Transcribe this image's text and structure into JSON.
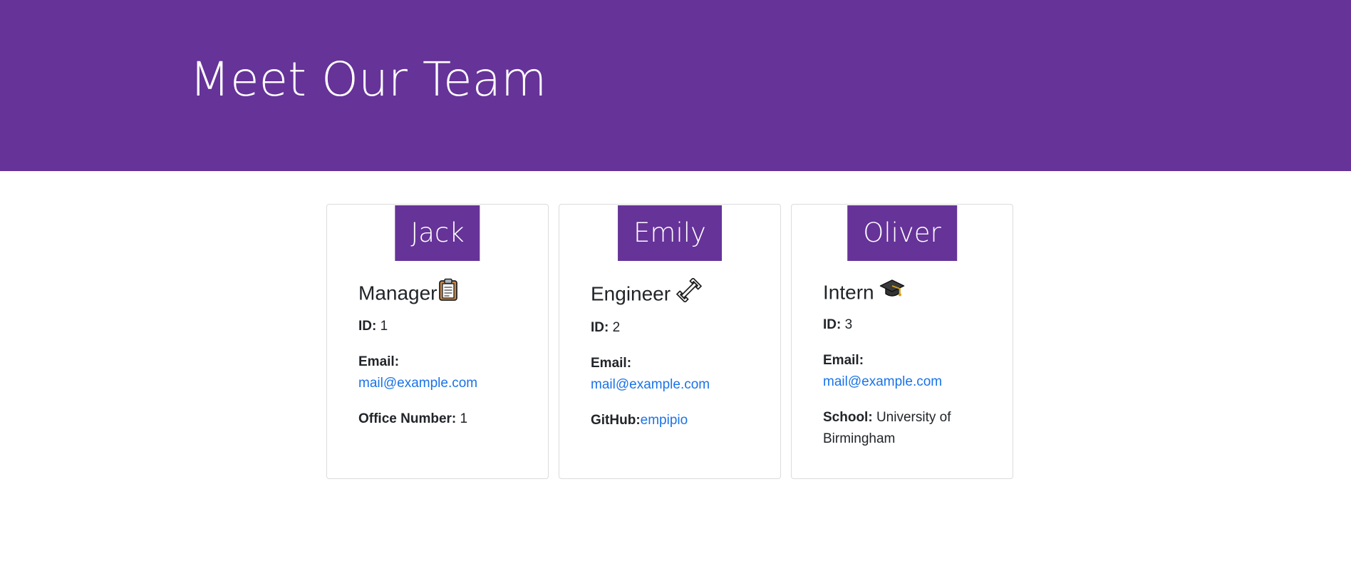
{
  "header": {
    "title": "Meet Our Team"
  },
  "colors": {
    "primary": "#663399",
    "link": "#1a73e8"
  },
  "team": [
    {
      "name": "Jack",
      "role": "Manager",
      "role_icon": "clipboard-icon",
      "id_label": "ID:",
      "id": "1",
      "email_label": "Email:",
      "email": "mail@example.com",
      "extra_label": "Office Number:",
      "extra_value": "1"
    },
    {
      "name": "Emily",
      "role": "Engineer",
      "role_icon": "wrench-icon",
      "id_label": "ID:",
      "id": "2",
      "email_label": "Email:",
      "email": "mail@example.com",
      "extra_label": "GitHub:",
      "extra_value": "empipio"
    },
    {
      "name": "Oliver",
      "role": "Intern",
      "role_icon": "graduation-cap-icon",
      "id_label": "ID:",
      "id": "3",
      "email_label": "Email:",
      "email": "mail@example.com",
      "extra_label": "School:",
      "extra_value": "University of Birmingham"
    }
  ]
}
